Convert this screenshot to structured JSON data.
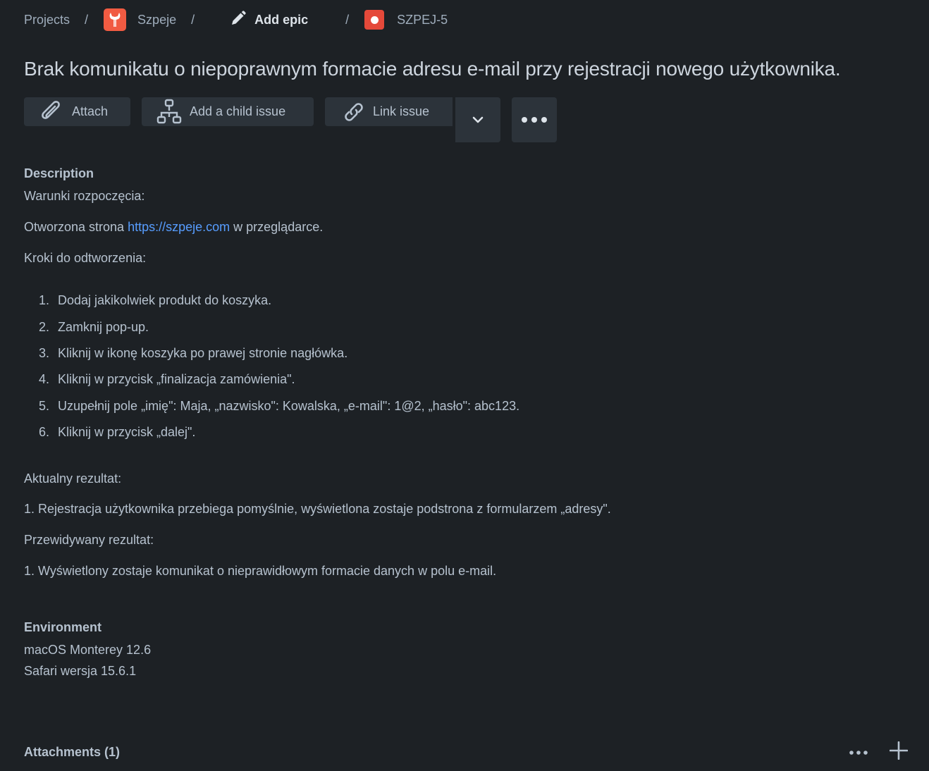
{
  "breadcrumb": {
    "projects": "Projects",
    "separator": "/",
    "project_name": "Szpeje",
    "project_icon": "wrench-app-icon",
    "add_epic": "Add epic",
    "issue_key": "SZPEJ-5"
  },
  "issue": {
    "title": "Brak komunikatu o niepoprawnym formacie adresu e-mail przy rejestracji nowego użytkownika."
  },
  "toolbar": {
    "attach": "Attach",
    "add_child": "Add a child issue",
    "link_issue": "Link issue"
  },
  "description": {
    "heading": "Description",
    "preconditions_label": "Warunki rozpoczęcia:",
    "opened_prefix": "Otworzona strona ",
    "opened_link": "https://szpeje.com",
    "opened_suffix": " w przeglądarce.",
    "steps_label": "Kroki do odtworzenia:",
    "steps": [
      {
        "num": "1.",
        "text": "Dodaj jakikolwiek produkt do koszyka."
      },
      {
        "num": "2.",
        "text": "Zamknij pop-up."
      },
      {
        "num": "3.",
        "text": "Kliknij w ikonę koszyka po prawej stronie nagłówka."
      },
      {
        "num": "4.",
        "text": "Kliknij w przycisk „finalizacja zamówienia\"."
      },
      {
        "num": "5.",
        "text": "Uzupełnij pole „imię\": Maja, „nazwisko\": Kowalska, „e-mail\": 1@2, „hasło\": abc123."
      },
      {
        "num": "6.",
        "text": "Kliknij w przycisk „dalej\"."
      }
    ],
    "actual_label": "Aktualny rezultat:",
    "actual_text": "1. Rejestracja użytkownika przebiega pomyślnie, wyświetlona zostaje podstrona z formularzem „adresy\".",
    "expected_label": "Przewidywany rezultat:",
    "expected_text": "1. Wyświetlony zostaje komunikat o nieprawidłowym formacie danych w polu e-mail."
  },
  "environment": {
    "heading": "Environment",
    "os": "macOS Monterey 12.6",
    "browser": "Safari wersja 15.6.1"
  },
  "attachments": {
    "heading": "Attachments (1)"
  },
  "colors": {
    "background": "#1d2125",
    "text": "#b6c2cf",
    "link": "#579dff",
    "button_bg": "#2c333a",
    "project_icon": "#f15b42",
    "bug_icon": "#e5493a"
  }
}
